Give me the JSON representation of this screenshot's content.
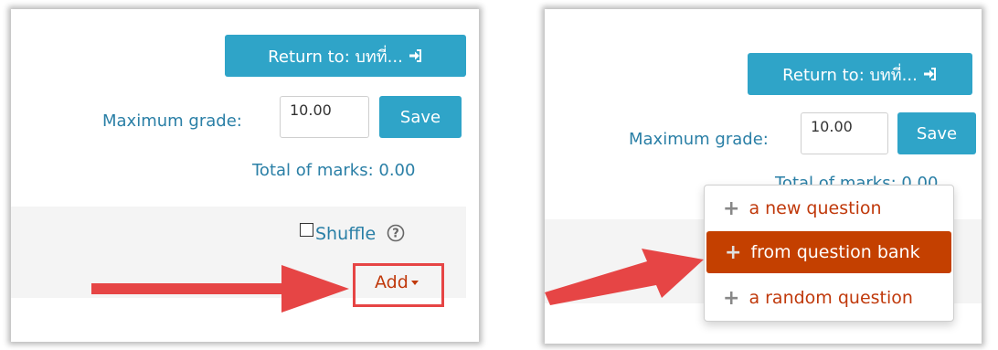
{
  "colors": {
    "primary_button": "#2fa4c8",
    "link_text": "#2a7fa6",
    "accent_orange": "#c0390b",
    "menu_active_bg": "#c44000",
    "arrow_red": "#e64545",
    "plus_gray": "#888888"
  },
  "left_panel": {
    "return_button": "Return to: บทที่...",
    "return_icon": "sign-in-icon",
    "max_grade_label": "Maximum grade:",
    "max_grade_value": "10.00",
    "save_button": "Save",
    "total_marks": "Total of marks: 0.00",
    "shuffle_label": "Shuffle",
    "help_icon": "question-circle-icon",
    "add_button": "Add"
  },
  "right_panel": {
    "return_button": "Return to: บทที่...",
    "max_grade_label": "Maximum grade:",
    "max_grade_value": "10.00",
    "save_button": "Save",
    "total_marks": "Total of marks: 0.00",
    "add_menu": {
      "items": [
        {
          "label": "a new question",
          "active": false
        },
        {
          "label": "from question bank",
          "active": true
        },
        {
          "label": "a random question",
          "active": false
        }
      ]
    }
  }
}
